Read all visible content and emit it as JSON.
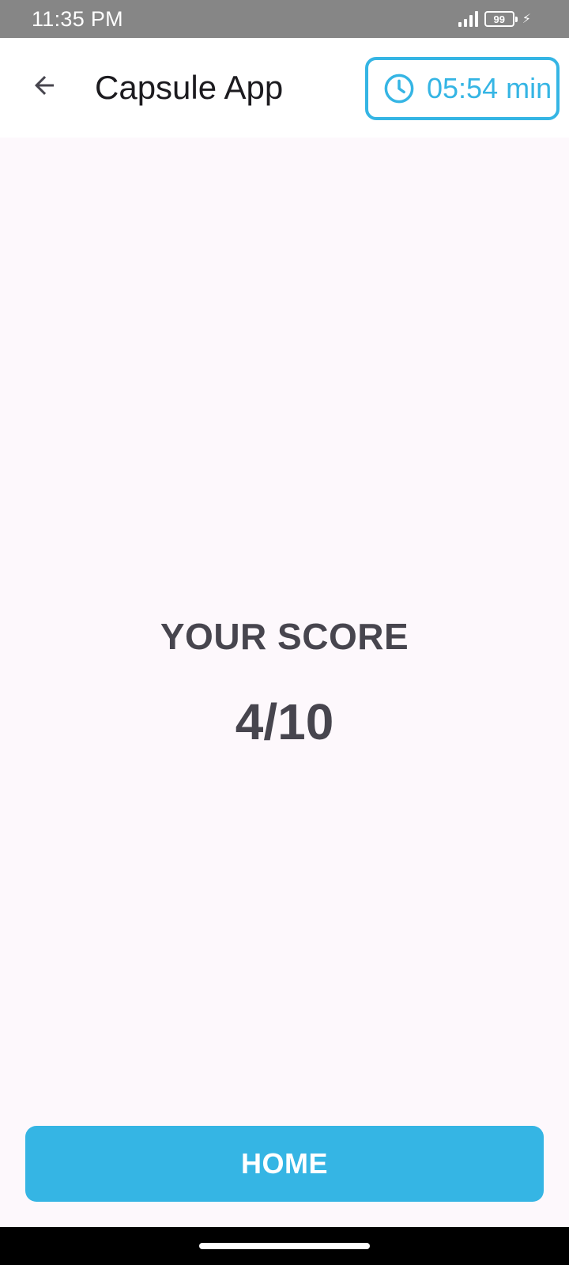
{
  "status_bar": {
    "time": "11:35 PM",
    "battery_level": "99",
    "icons": [
      "signal-icon",
      "battery-icon",
      "charging-icon"
    ]
  },
  "app_bar": {
    "back_icon": "arrow-back-icon",
    "title": "Capsule App",
    "timer_icon": "clock-icon",
    "timer": "05:54 min"
  },
  "result": {
    "label": "YOUR SCORE",
    "score": "4/10"
  },
  "actions": {
    "home_label": "HOME"
  },
  "colors": {
    "accent": "#35b5e4",
    "text_dark": "#47454e",
    "background": "#fdf8fc",
    "status_bar": "#868686"
  }
}
